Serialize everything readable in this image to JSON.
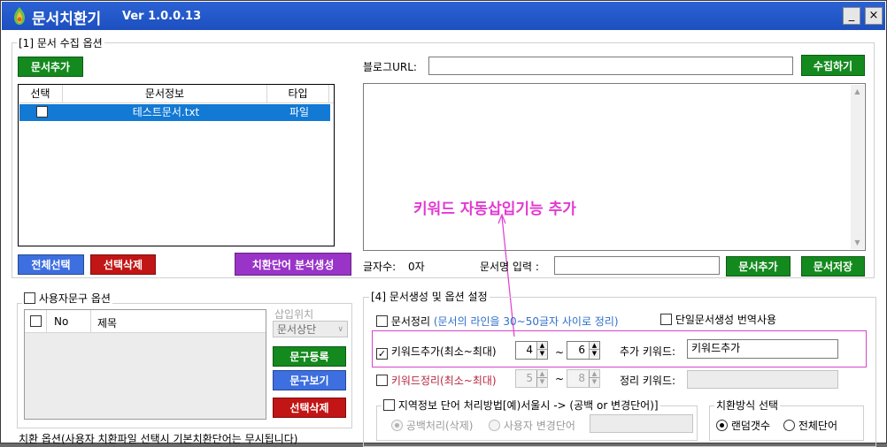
{
  "window": {
    "title": "문서치환기",
    "version": "Ver 1.0.0.13",
    "minimize": "_",
    "close": "×"
  },
  "collect": {
    "group_label": "[1] 문서 수집 옵션",
    "add_doc_button": "문서추가",
    "blog_url_label": "블로그URL:",
    "blog_url_value": "",
    "collect_button": "수집하기",
    "list": {
      "headers": [
        "선택",
        "문서정보",
        "타입"
      ],
      "rows": [
        {
          "checked": false,
          "info": "테스트문서.txt",
          "type": "파일"
        }
      ]
    },
    "select_all_button": "전체선택",
    "delete_selected_button": "선택삭제",
    "analyze_button": "치환단어 분석생성",
    "char_count_label": "글자수:",
    "char_count_value": "0자",
    "doc_name_label": "문서명 입력 :",
    "doc_name_value": "",
    "add_doc_button2": "문서추가",
    "save_doc_button": "문서저장"
  },
  "annotation": {
    "text": "키워드 자동삽입기능 추가",
    "color": "#e23ad0"
  },
  "user_phrase": {
    "group_label": "사용자문구 옵션",
    "enabled": false,
    "headers": [
      "",
      "No",
      "제목"
    ],
    "insert_position_label": "삽입위치",
    "insert_position_value": "문서상단",
    "register_button": "문구등록",
    "view_button": "문구보기",
    "delete_button": "선택삭제"
  },
  "replace_options": {
    "group_label": "치환 옵션(사용자 치환파일 선택시 기본치환단어는 무시됩니다)"
  },
  "generate": {
    "group_label": "[4] 문서생성 및 옵션 설정",
    "doc_cleanup_label": "문서정리",
    "doc_cleanup_checked": false,
    "doc_cleanup_hint": "(문서의 라인을 30~50글자 사이로 정리)",
    "single_translate_label": "단일문서생성 번역사용",
    "single_translate_checked": false,
    "keyword_add_label": "키워드추가(최소~최대)",
    "keyword_add_checked": true,
    "keyword_add_min": "4",
    "keyword_add_max": "6",
    "tilde": "~",
    "extra_keyword_label": "추가 키워드:",
    "extra_keyword_value": "키워드추가",
    "keyword_cleanup_label": "키워드정리(최소~최대)",
    "keyword_cleanup_checked": false,
    "keyword_cleanup_min": "5",
    "keyword_cleanup_max": "8",
    "cleanup_keyword_label": "정리 키워드:",
    "cleanup_keyword_value": "",
    "region_label": "지역정보 단어 처리방법[예)서울시 -> (공백 or 변경단어)]",
    "region_checked": false,
    "region_blank_label": "공백처리(삭제)",
    "region_user_label": "사용자 변경단어",
    "region_user_value": "",
    "replace_method_label": "치환방식 선택",
    "random_label": "랜덤갯수",
    "all_words_label": "전체단어",
    "replace_method_selected": "random"
  },
  "colors": {
    "titlebar": "#2b62d4",
    "green": "#148a1e",
    "red": "#c21515",
    "blue": "#3d6fe0",
    "purple": "#9a34c9",
    "selection": "#1279d4",
    "hint_blue": "#2f6fc9",
    "hint_red": "#b5263e"
  }
}
